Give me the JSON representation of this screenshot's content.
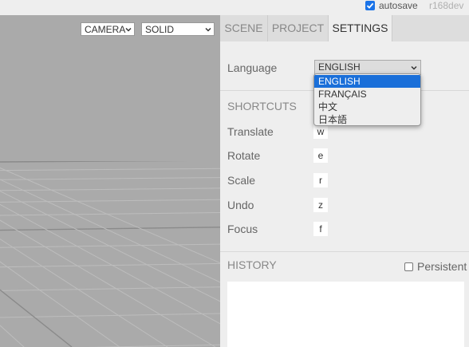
{
  "topbar": {
    "autosave_label": "autosave",
    "autosave_checked": true,
    "version": "r168dev"
  },
  "viewport": {
    "camera_value": "CAMERA",
    "shading_value": "SOLID"
  },
  "tabs": [
    {
      "label": "SCENE",
      "active": false
    },
    {
      "label": "PROJECT",
      "active": false
    },
    {
      "label": "SETTINGS",
      "active": true
    }
  ],
  "settings": {
    "language_label": "Language",
    "language_value": "ENGLISH",
    "language_options": [
      "ENGLISH",
      "FRANÇAIS",
      "中文",
      "日本語"
    ]
  },
  "shortcuts": {
    "title": "SHORTCUTS",
    "items": [
      {
        "label": "Translate",
        "key": "w"
      },
      {
        "label": "Rotate",
        "key": "e"
      },
      {
        "label": "Scale",
        "key": "r"
      },
      {
        "label": "Undo",
        "key": "z"
      },
      {
        "label": "Focus",
        "key": "f"
      }
    ]
  },
  "history": {
    "title": "HISTORY",
    "persistent_label": "Persistent",
    "persistent_checked": false
  },
  "colors": {
    "viewport_bg": "#aaaaaa",
    "panel_bg": "#eeeeee",
    "accent": "#1a6fd9"
  }
}
